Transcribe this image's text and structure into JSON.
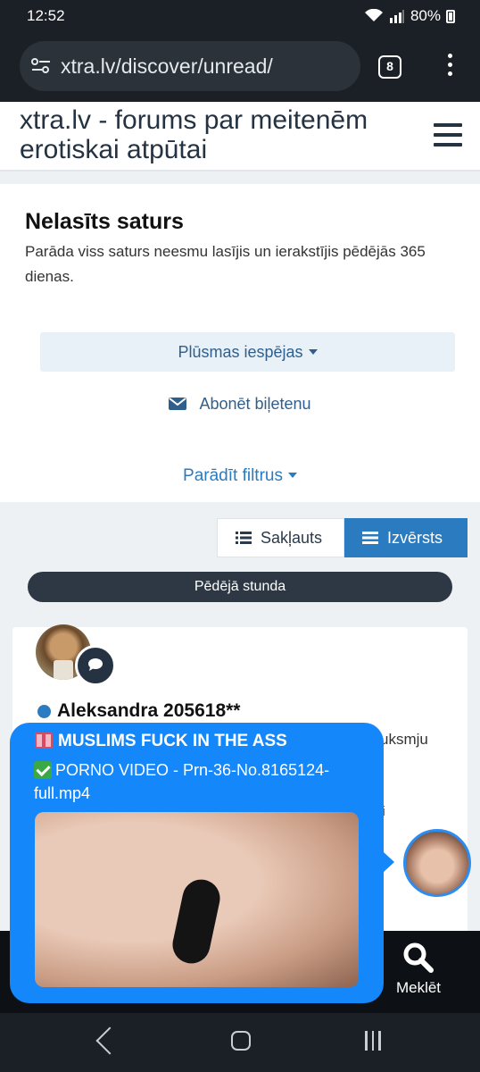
{
  "status_bar": {
    "time": "12:52",
    "battery": "80%"
  },
  "browser": {
    "url": "xtra.lv/discover/unread/",
    "tab_count": "8"
  },
  "site": {
    "title": "xtra.lv - forums par meitenēm erotiskai atpūtai"
  },
  "page": {
    "heading": "Nelasīts saturs",
    "description": "Parāda viss saturs neesmu lasījis un ierakstījis pēdējās 365 dienas.",
    "feed_options_label": "Plūsmas iespējas",
    "subscribe_label": "Abonēt biļetenu",
    "show_filters_label": "Parādīt filtrus"
  },
  "view_toggle": {
    "collapsed_label": "Sakļauts",
    "expanded_label": "Izvērsts"
  },
  "time_divider": "Pēdējā stunda",
  "item": {
    "author": "Aleksandra 205618**",
    "snippet_line_1": "uksmju",
    "snippet_line_2": "ai"
  },
  "bottom_nav": {
    "search_label": "Meklēt"
  },
  "popup": {
    "title": "MUSLIMS FUCK IN THE ASS",
    "body": "PORNO VIDEO - Prn-36-No.8165124-full.mp4"
  },
  "colors": {
    "accent": "#2a7bbf",
    "popup": "#1487fb",
    "dark": "#243242"
  }
}
